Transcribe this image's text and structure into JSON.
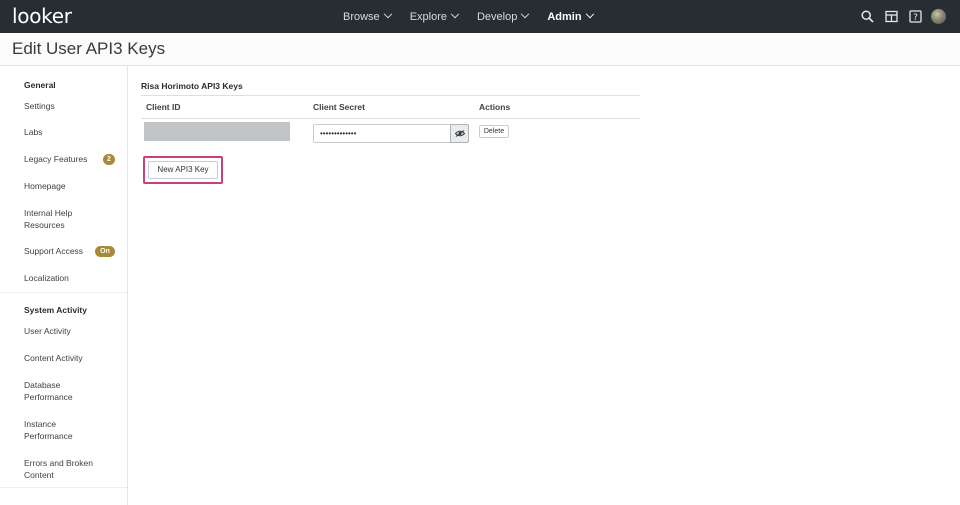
{
  "app": {
    "logo_text": "looker"
  },
  "nav": {
    "items": [
      {
        "label": "Browse",
        "active": false
      },
      {
        "label": "Explore",
        "active": false
      },
      {
        "label": "Develop",
        "active": false
      },
      {
        "label": "Admin",
        "active": true
      }
    ],
    "icons": [
      "search-icon",
      "marketplace-icon",
      "help-icon",
      "avatar"
    ]
  },
  "page": {
    "title": "Edit User API3 Keys"
  },
  "sidebar": {
    "sections": [
      {
        "title": "General",
        "items": [
          {
            "label": "Settings"
          },
          {
            "label": "Labs"
          },
          {
            "label": "Legacy Features",
            "badge": "2"
          },
          {
            "label": "Homepage"
          },
          {
            "label": "Internal Help Resources"
          },
          {
            "label": "Support Access",
            "badge": "On"
          },
          {
            "label": "Localization"
          }
        ]
      },
      {
        "title": "System Activity",
        "items": [
          {
            "label": "User Activity"
          },
          {
            "label": "Content Activity"
          },
          {
            "label": "Database Performance"
          },
          {
            "label": "Instance Performance"
          },
          {
            "label": "Errors and Broken Content"
          }
        ]
      }
    ]
  },
  "keys": {
    "section_title": "Risa Horimoto API3 Keys",
    "columns": [
      "Client ID",
      "Client Secret",
      "Actions"
    ],
    "rows": [
      {
        "client_secret_masked": "•••••••••••••",
        "action_label": "Delete"
      }
    ],
    "new_key_label": "New API3 Key"
  },
  "colors": {
    "topbar": "#262d33",
    "badge": "#a8893a",
    "highlight": "#c7417b"
  }
}
